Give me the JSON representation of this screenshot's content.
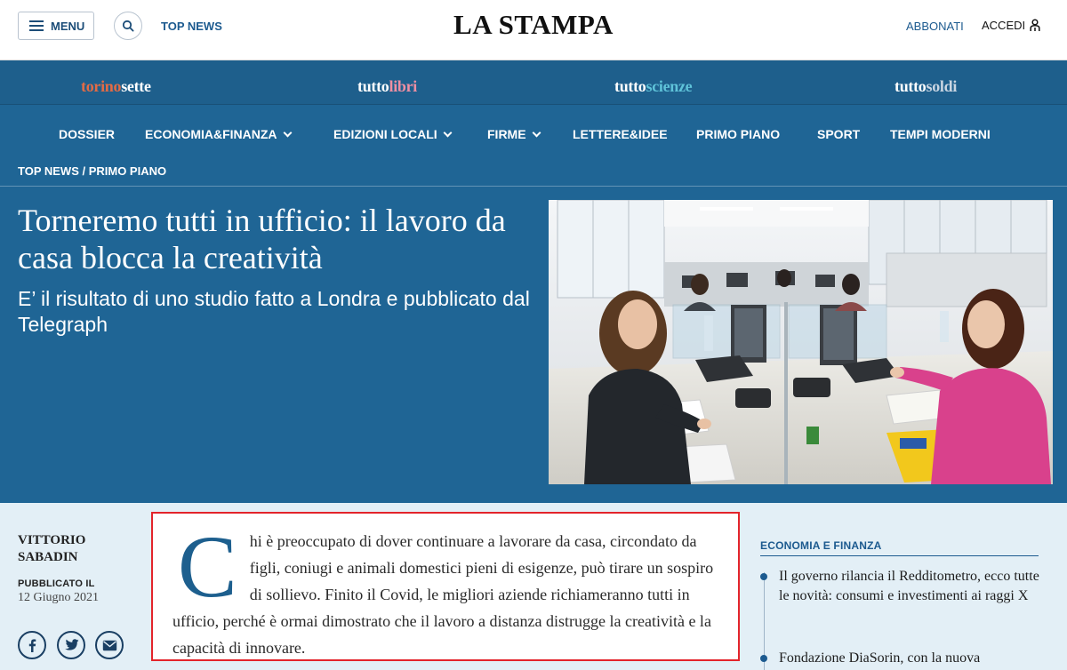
{
  "header": {
    "menu_label": "MENU",
    "top_news_label": "TOP NEWS",
    "logo": "LA STAMPA",
    "subscribe_label": "ABBONATI",
    "login_label": "ACCEDI"
  },
  "supplements": [
    {
      "a": "torino",
      "b": "sette"
    },
    {
      "a": "tutto",
      "b": "libri"
    },
    {
      "a": "tutto",
      "b": "scienze"
    },
    {
      "a": "tutto",
      "b": "soldi"
    }
  ],
  "sections": [
    {
      "label": "DOSSIER"
    },
    {
      "label": "ECONOMIA&FINANZA"
    },
    {
      "label": "EDIZIONI LOCALI"
    },
    {
      "label": "FIRME"
    },
    {
      "label": "LETTERE&IDEE"
    },
    {
      "label": "PRIMO PIANO"
    },
    {
      "label": "SPORT"
    },
    {
      "label": "TEMPI MODERNI"
    }
  ],
  "breadcrumb": "TOP NEWS / PRIMO PIANO",
  "article": {
    "headline": "Torneremo tutti in ufficio: il lavoro da casa blocca la creatività",
    "subheadline": "E’ il risultato di uno studio fatto a Londra e pubblicato dal Telegraph",
    "author": "VITTORIO SABADIN",
    "published_label": "PUBBLICATO IL",
    "published_date": "12 Giugno 2021",
    "dropcap": "C",
    "body": "hi è preoccupato di dover continuare a lavorare da casa, circondato da figli, coniugi e animali domestici pieni di esigenze, può tirare un sospiro di sollievo. Finito il Covid, le migliori aziende richiameranno tutti in ufficio, perché è ormai dimostrato che il lavoro a distanza distrugge la creatività e la capacità di innovare."
  },
  "sidebar": {
    "title": "ECONOMIA E FINANZA",
    "items": [
      {
        "text": "Il governo rilancia il Redditometro, ecco tutte le novità: consumi e investimenti ai raggi X"
      },
      {
        "text": "Fondazione DiaSorin, con la nuova"
      }
    ]
  },
  "colors": {
    "brand_blue": "#1f6595",
    "highlight_red": "#e3242b"
  }
}
